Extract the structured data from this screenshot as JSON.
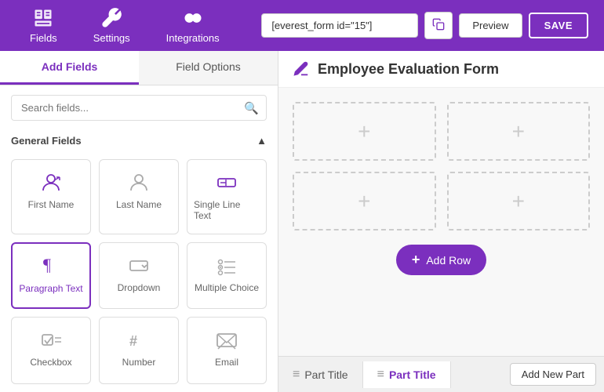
{
  "navbar": {
    "items": [
      {
        "id": "fields",
        "label": "Fields"
      },
      {
        "id": "settings",
        "label": "Settings"
      },
      {
        "id": "integrations",
        "label": "Integrations"
      }
    ],
    "shortcode": "[everest_form id=\"15\"]",
    "preview_label": "Preview",
    "save_label": "SAVE"
  },
  "left_panel": {
    "tabs": [
      {
        "id": "add-fields",
        "label": "Add Fields"
      },
      {
        "id": "field-options",
        "label": "Field Options"
      }
    ],
    "active_tab": "add-fields",
    "search_placeholder": "Search fields...",
    "section_title": "General Fields",
    "fields": [
      {
        "id": "first-name",
        "label": "First Name"
      },
      {
        "id": "last-name",
        "label": "Last Name"
      },
      {
        "id": "single-line-text",
        "label": "Single Line Text"
      },
      {
        "id": "paragraph-text",
        "label": "Paragraph Text",
        "active": true
      },
      {
        "id": "dropdown",
        "label": "Dropdown"
      },
      {
        "id": "multiple-choice",
        "label": "Multiple Choice"
      },
      {
        "id": "checkbox",
        "label": "Checkbox"
      },
      {
        "id": "number",
        "label": "Number"
      },
      {
        "id": "email",
        "label": "Email"
      }
    ]
  },
  "right_panel": {
    "form_title": "Employee Evaluation Form",
    "add_row_label": "Add Row",
    "drop_zones": [
      [
        1,
        2
      ],
      [
        3,
        4
      ]
    ]
  },
  "part_bar": {
    "parts": [
      {
        "id": "part-1",
        "label": "Part Title"
      },
      {
        "id": "part-2",
        "label": "Part Title",
        "active": true
      }
    ],
    "add_part_label": "Add New Part"
  }
}
